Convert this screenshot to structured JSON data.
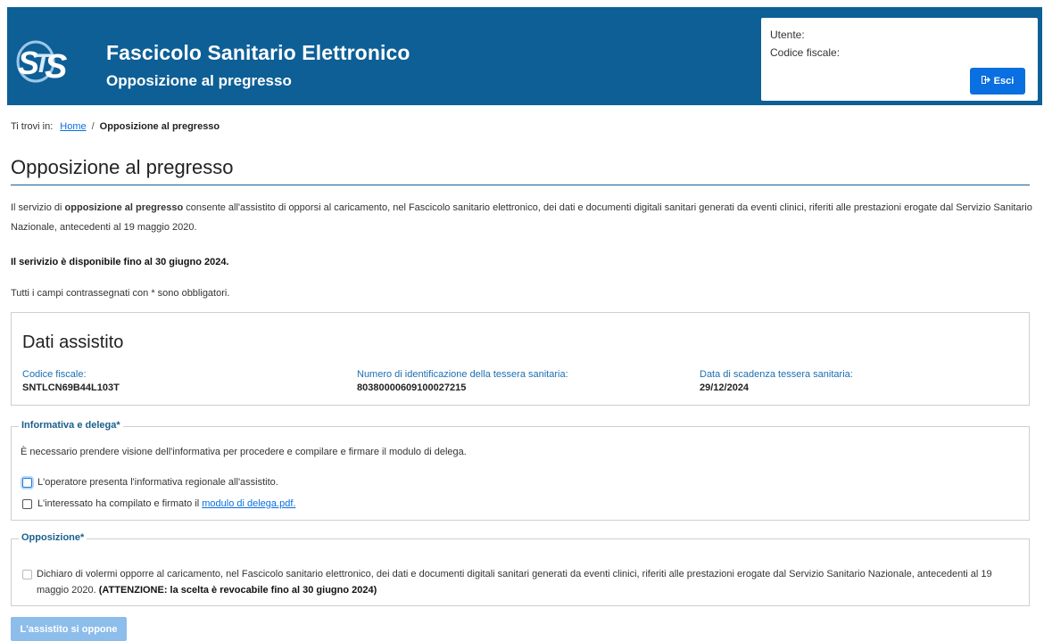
{
  "header": {
    "logo_text": "STS",
    "title": "Fascicolo Sanitario Elettronico",
    "subtitle": "Opposizione al pregresso",
    "user_label": "Utente:",
    "cf_label": "Codice fiscale:",
    "logout_label": "Esci",
    "logout_icon": "sign-out-icon"
  },
  "breadcrumb": {
    "prefix": "Ti trovi in:",
    "home": "Home",
    "separator": "/",
    "current": "Opposizione al pregresso"
  },
  "page": {
    "title": "Opposizione al pregresso",
    "intro_pre": "Il servizio di ",
    "intro_bold": "opposizione al pregresso",
    "intro_post": " consente all'assistito di opporsi al caricamento, nel Fascicolo sanitario elettronico, dei dati e documenti digitali sanitari generati da eventi clinici, riferiti alle prestazioni erogate dal Servizio Sanitario Nazionale, antecedenti al 19 maggio 2020.",
    "availability": "Il serivizio è disponibile fino al 30 giugno 2024.",
    "required_note": "Tutti i campi contrassegnati con * sono obbligatori."
  },
  "dati_assistito": {
    "title": "Dati assistito",
    "fields": [
      {
        "label": "Codice fiscale:",
        "value": "SNTLCN69B44L103T"
      },
      {
        "label": "Numero di identificazione della tessera sanitaria:",
        "value": "80380000609100027215"
      },
      {
        "label": "Data di scadenza tessera sanitaria:",
        "value": "29/12/2024"
      }
    ]
  },
  "informativa": {
    "legend": "Informativa e delega*",
    "text": "È necessario prendere visione dell'informativa per procedere e compilare e firmare il modulo di delega.",
    "check1": "L'operatore presenta l'informativa regionale all'assistito.",
    "check2": "L'interessato ha compilato e firmato il",
    "check2_link": "modulo di delega.pdf."
  },
  "opposizione": {
    "legend": "Opposizione*",
    "text": "Dichiaro di volermi opporre al caricamento, nel Fascicolo sanitario elettronico, dei dati e documenti digitali sanitari generati da eventi clinici, riferiti alle prestazioni erogate dal Servizio Sanitario Nazionale, antecedenti al 19 maggio 2020. ",
    "warning": "(ATTENZIONE: la scelta è revocabile fino al 30 giugno 2024)"
  },
  "submit_label": "L'assistito si oppone",
  "colors": {
    "header_bg": "#0d5f96",
    "primary_button": "#0a6fe0",
    "disabled_button": "#8dbdea"
  }
}
